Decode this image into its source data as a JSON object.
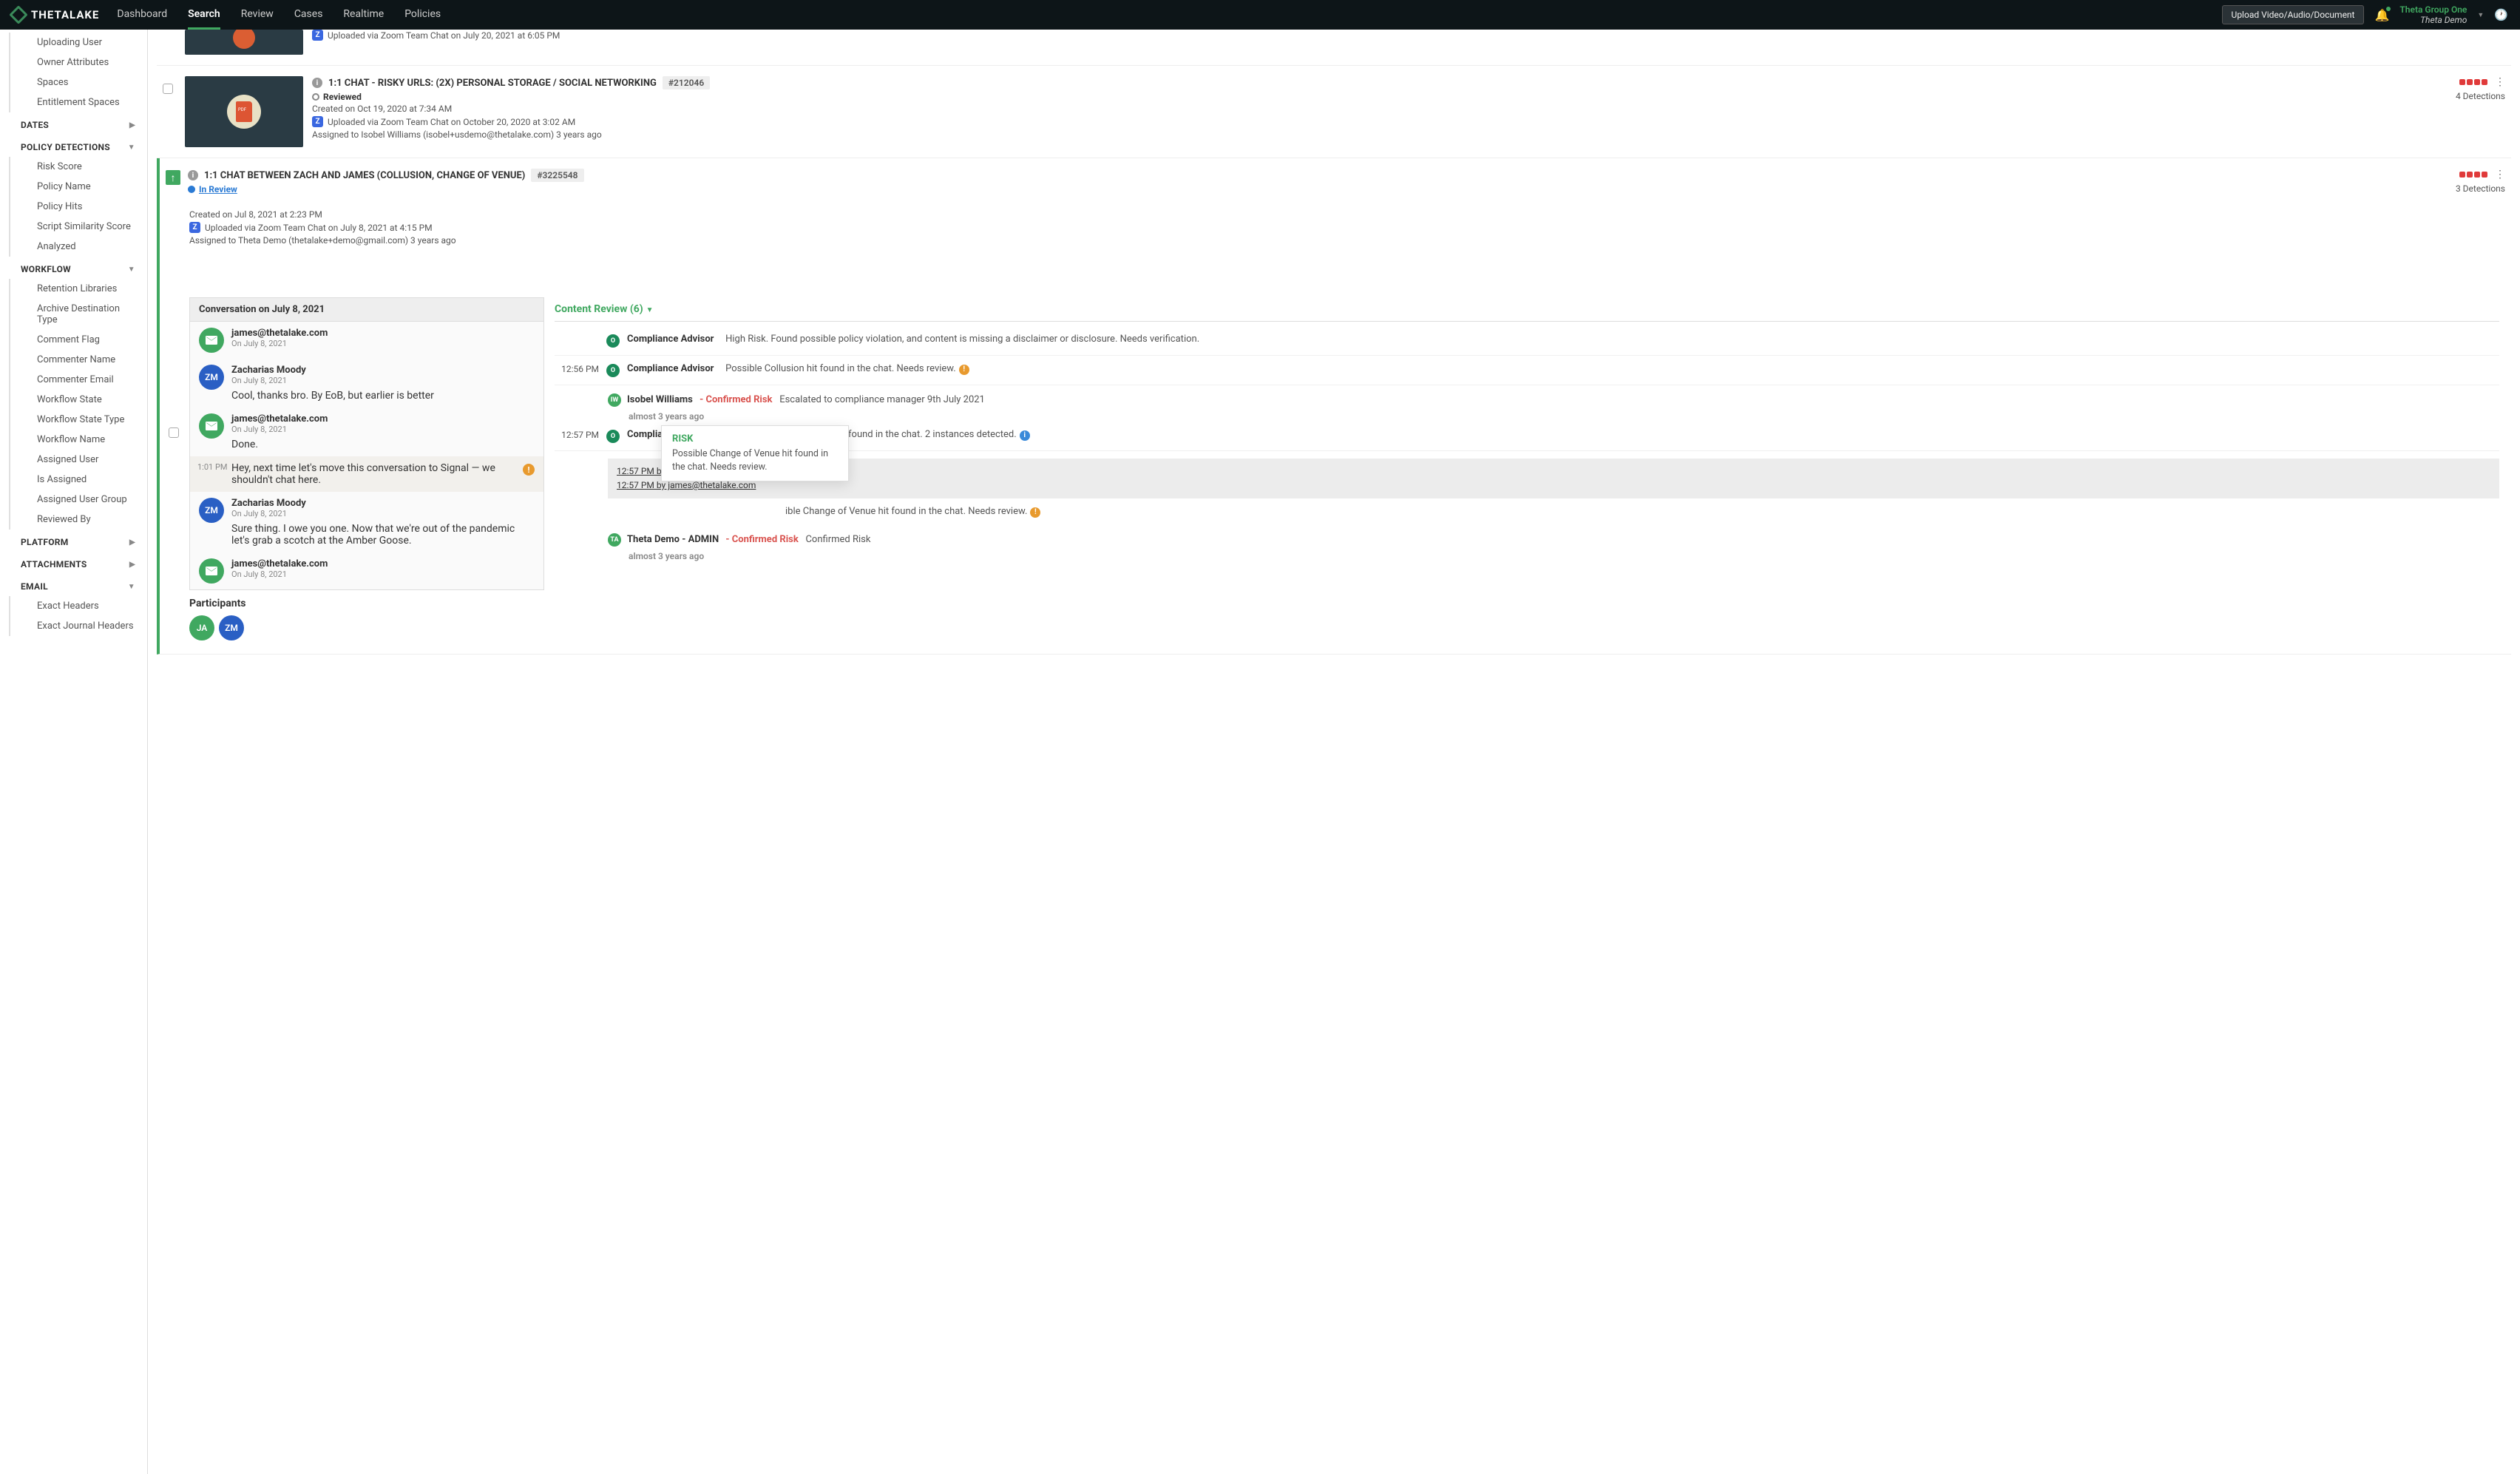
{
  "nav": {
    "brand": "THETALAKE",
    "items": [
      "Dashboard",
      "Search",
      "Review",
      "Cases",
      "Realtime",
      "Policies"
    ],
    "active": "Search",
    "upload": "Upload Video/Audio/Document",
    "user_group": "Theta Group One",
    "user_name": "Theta Demo"
  },
  "sidebar": {
    "loose_items_top": [
      "Uploading User",
      "Owner Attributes",
      "Spaces",
      "Entitlement Spaces"
    ],
    "sections": [
      {
        "title": "DATES",
        "caret": "▶",
        "items": []
      },
      {
        "title": "POLICY DETECTIONS",
        "caret": "▼",
        "items": [
          "Risk Score",
          "Policy Name",
          "Policy Hits",
          "Script Similarity Score",
          "Analyzed"
        ]
      },
      {
        "title": "WORKFLOW",
        "caret": "▼",
        "items": [
          "Retention Libraries",
          "Archive Destination Type",
          "Comment Flag",
          "Commenter Name",
          "Commenter Email",
          "Workflow State",
          "Workflow State Type",
          "Workflow Name",
          "Assigned User",
          "Is Assigned",
          "Assigned User Group",
          "Reviewed By"
        ]
      },
      {
        "title": "PLATFORM",
        "caret": "▶",
        "items": []
      },
      {
        "title": "ATTACHMENTS",
        "caret": "▶",
        "items": []
      },
      {
        "title": "EMAIL",
        "caret": "▼",
        "items": [
          "Exact Headers",
          "Exact Journal Headers"
        ]
      }
    ]
  },
  "results": [
    {
      "thumb": "camera",
      "uploaded": "Uploaded via Zoom Team Chat on July 20, 2021 at 6:05 PM"
    },
    {
      "thumb": "pdf",
      "title": "1:1 CHAT - RISKY URLS: (2X) PERSONAL STORAGE / SOCIAL NETWORKING",
      "id": "#212046",
      "status": "Reviewed",
      "status_class": "reviewed",
      "created": "Created on Oct 19, 2020 at 7:34 AM",
      "uploaded": "Uploaded via Zoom Team Chat on October 20, 2020 at 3:02 AM",
      "assigned": "Assigned to Isobel Williams (isobel+usdemo@thetalake.com) 3 years ago",
      "detections": "4 Detections",
      "bars": 4
    }
  ],
  "active_result": {
    "title": "1:1 CHAT BETWEEN ZACH AND JAMES (COLLUSION, CHANGE OF VENUE)",
    "id": "#3225548",
    "status": "In Review",
    "created": "Created on Jul 8, 2021 at 2:23 PM",
    "uploaded": "Uploaded via Zoom Team Chat on July 8, 2021 at 4:15 PM",
    "assigned": "Assigned to Theta Demo (thetalake+demo@gmail.com) 3 years ago",
    "detections": "3 Detections",
    "bars": 4,
    "convo_header": "Conversation on July 8, 2021",
    "messages": [
      {
        "author": "james@thetalake.com",
        "avatar": "mail",
        "date": "On July 8, 2021",
        "text": ""
      },
      {
        "author": "Zacharias Moody",
        "avatar": "ZM",
        "date": "On July 8, 2021",
        "text": "Cool, thanks bro. By EoB, but earlier is better"
      },
      {
        "author": "james@thetalake.com",
        "avatar": "mail",
        "date": "On July 8, 2021",
        "text": "Done."
      },
      {
        "author": "",
        "avatar": "",
        "date": "",
        "time": "1:01 PM",
        "text": "Hey, next time let's move this conversation to Signal — we shouldn't chat here.",
        "highlighted": true,
        "warn": true
      },
      {
        "author": "Zacharias Moody",
        "avatar": "ZM",
        "date": "On July 8, 2021",
        "text": "Sure thing. I owe you one. Now that we're out of the pandemic let's grab a scotch at the Amber Goose."
      },
      {
        "author": "james@thetalake.com",
        "avatar": "mail",
        "date": "On July 8, 2021",
        "text": ""
      }
    ],
    "participants_label": "Participants",
    "participants": [
      "JA",
      "ZM"
    ]
  },
  "content_review": {
    "header": "Content Review (6)",
    "items": [
      {
        "time": "",
        "icon": "O",
        "title": "Compliance Advisor",
        "text": "High Risk. Found possible policy violation, and content is missing a disclaimer or disclosure. Needs verification."
      },
      {
        "time": "12:56 PM",
        "icon": "O",
        "title": "Compliance Advisor",
        "text": "Possible Collusion hit found in the chat. Needs review.",
        "bubble": "orange"
      },
      {
        "sub": true,
        "icon": "IW",
        "title": "Isobel Williams",
        "risk": "- Confirmed Risk",
        "text": "Escalated to compliance manager 9th July 2021",
        "ago": "almost 3 years ago"
      },
      {
        "time": "12:57 PM",
        "icon": "O",
        "title": "Compliance Advisor",
        "text": "Needs verification: Profanity found in the chat. 2 instances detected.",
        "bubble": "blue"
      },
      {
        "timestamps": [
          "12:57 PM  by james@thetalake.com",
          "12:57 PM  by james@thetalake.com"
        ]
      },
      {
        "time": "",
        "icon": "",
        "title": "",
        "text_prefix": "ible Change of Venue hit found in the chat. Needs review.",
        "bubble": "orange",
        "partial": true
      },
      {
        "sub": true,
        "icon": "TA",
        "title": "Theta Demo - ADMIN",
        "risk": "- Confirmed Risk",
        "text": "Confirmed Risk",
        "ago": "almost 3 years ago"
      }
    ]
  },
  "tooltip": {
    "title": "RISK",
    "text": "Possible Change of Venue hit found in the chat. Needs review."
  }
}
